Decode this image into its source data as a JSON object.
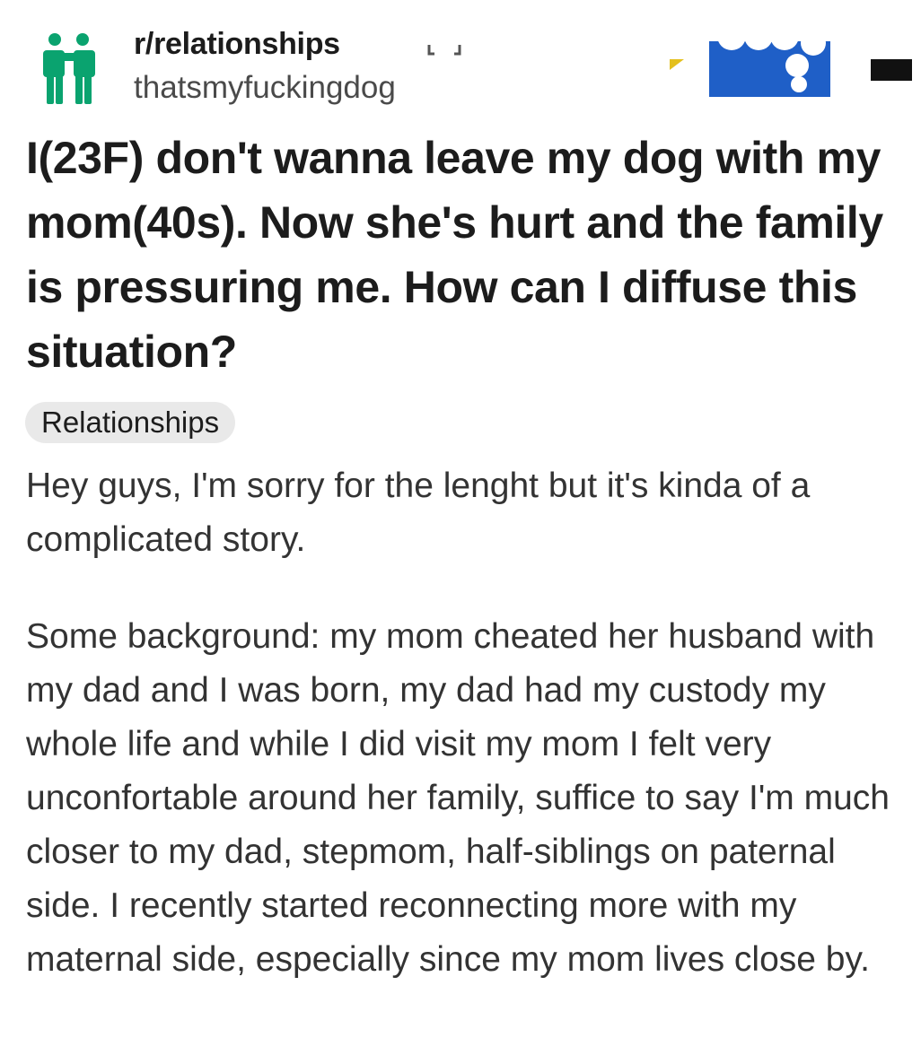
{
  "post": {
    "subreddit": "r/relationships",
    "author": "thatsmyfuckingdog",
    "title": "I(23F) don't wanna leave my dog with my mom(40s). Now she's hurt and the family is pressuring me. How can I diffuse this situation?",
    "flair": "Relationships",
    "paragraphs": [
      "Hey guys, I'm sorry for the lenght but it's kinda of a complicated story.",
      "Some background: my mom cheated her husband with my dad and I was born, my dad had my custody my whole life and while I did visit my mom I felt very unconfortable around her family, suffice to say I'm much closer to my dad, stepmom, half-siblings on paternal side. I recently started reconnecting more with my maternal side, especially since my mom lives close by."
    ]
  },
  "icons": {
    "subreddit": "relationships-couple-icon",
    "redaction": "redaction-marks"
  },
  "colors": {
    "subreddit_icon": "#0aa36f",
    "redaction_blue": "#1f5fc7",
    "flair_bg": "#e9e9e9",
    "title_text": "#1c1c1c",
    "body_text": "#333333"
  }
}
